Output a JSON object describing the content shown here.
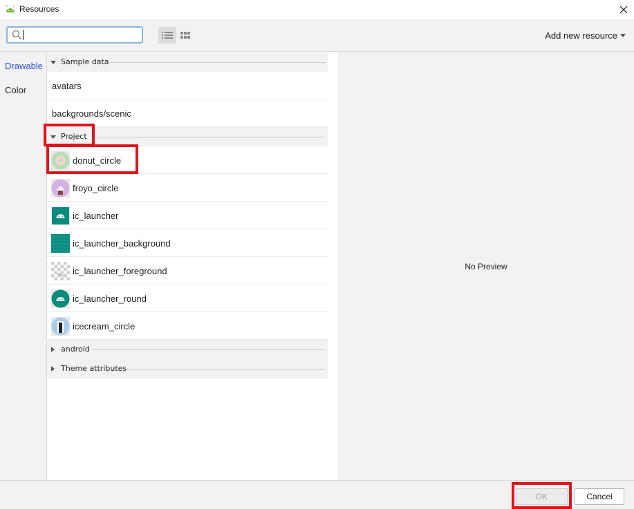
{
  "window": {
    "title": "Resources",
    "close_icon": "close-icon"
  },
  "toolbar": {
    "search": {
      "value": "",
      "placeholder": ""
    },
    "add_new_resource": "Add new resource"
  },
  "sidebar": {
    "items": [
      {
        "label": "Drawable",
        "active": true
      },
      {
        "label": "Color",
        "active": false
      }
    ]
  },
  "groups": {
    "sample_data": {
      "label": "Sample data",
      "items": [
        "avatars",
        "backgrounds/scenic"
      ]
    },
    "project": {
      "label": "Project",
      "items": [
        {
          "label": "donut_circle",
          "icon": "donut-thumbnail"
        },
        {
          "label": "froyo_circle",
          "icon": "froyo-thumbnail"
        },
        {
          "label": "ic_launcher",
          "icon": "android-launcher-thumbnail"
        },
        {
          "label": "ic_launcher_background",
          "icon": "teal-grid-thumbnail"
        },
        {
          "label": "ic_launcher_foreground",
          "icon": "transparent-checker-thumbnail"
        },
        {
          "label": "ic_launcher_round",
          "icon": "android-round-thumbnail"
        },
        {
          "label": "icecream_circle",
          "icon": "icecream-thumbnail"
        }
      ]
    },
    "android": {
      "label": "android"
    },
    "theme_attributes": {
      "label": "Theme attributes"
    }
  },
  "preview": {
    "text": "No Preview"
  },
  "footer": {
    "ok_label": "OK",
    "cancel_label": "Cancel"
  },
  "colors": {
    "accent_link": "#2f55d4",
    "highlight": "#e0141c",
    "panel_bg": "#f2f2f2",
    "teal": "#0b8a7e"
  }
}
